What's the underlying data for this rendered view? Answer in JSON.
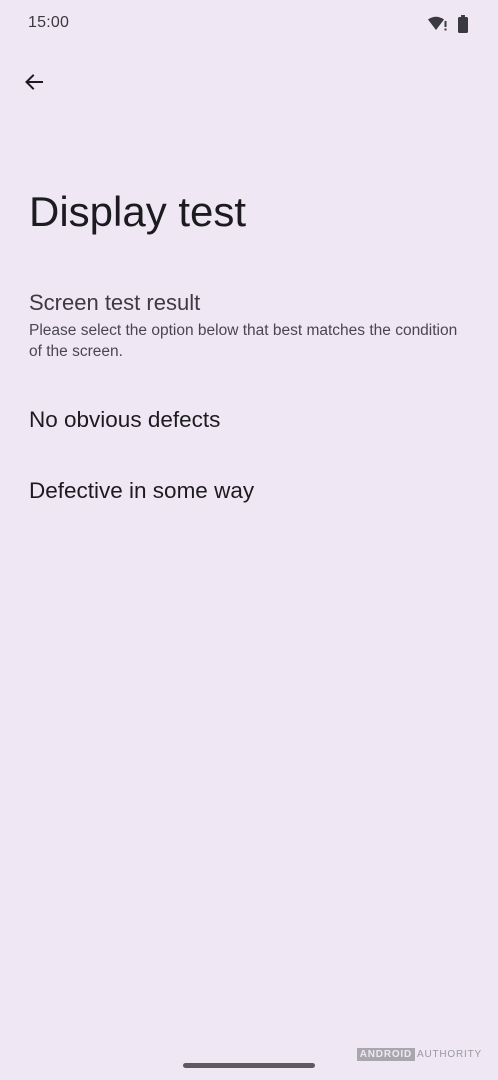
{
  "status_bar": {
    "time": "15:00",
    "icons": [
      "wifi-alert-icon",
      "battery-icon"
    ]
  },
  "header": {
    "back_icon": "arrow-left-icon"
  },
  "page": {
    "title": "Display test",
    "section_title": "Screen test result",
    "section_description": "Please select the option below that best matches the condition of the screen.",
    "options": [
      {
        "label": "No obvious defects"
      },
      {
        "label": "Defective in some way"
      }
    ]
  },
  "watermark": {
    "part1": "ANDROID",
    "part2": "AUTHORITY"
  },
  "colors": {
    "background": "#efe8f4",
    "text_primary": "#1d1b20",
    "text_secondary": "#4a4651"
  }
}
